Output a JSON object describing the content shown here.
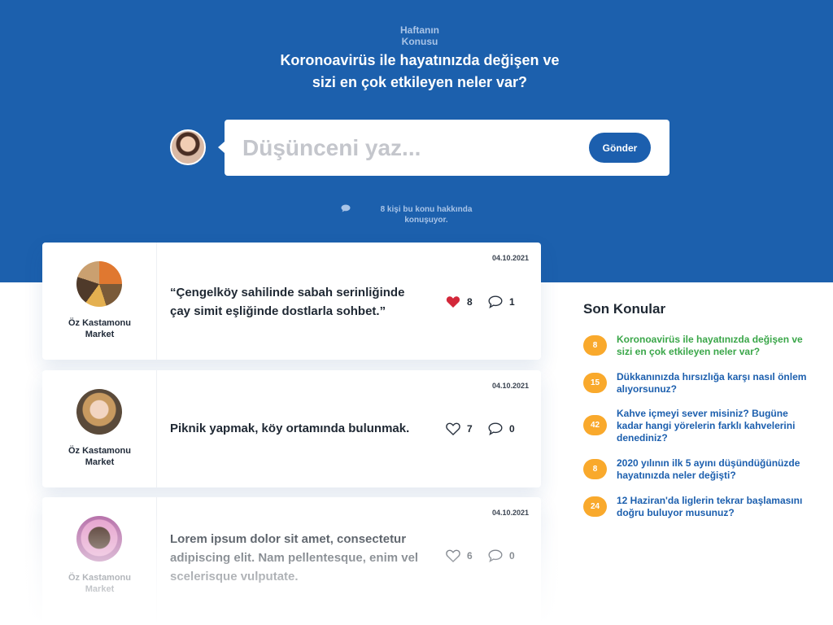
{
  "hero": {
    "kicker_line1": "Haftanın",
    "kicker_line2": "Konusu",
    "title_line1": "Koronoavirüs ile hayatınızda değişen ve",
    "title_line2": "sizi en çok etkileyen neler var?",
    "bg_color": "#1c60ad"
  },
  "composer": {
    "placeholder": "Düşünceni yaz...",
    "send_label": "Gönder",
    "user_avatar_icon": "user-avatar"
  },
  "talking": {
    "icon": "comment-icon",
    "line1": "8 kişi bu konu hakkında",
    "line2": "konuşuyor."
  },
  "posts": [
    {
      "author_line1": "Öz Kastamonu",
      "author_line2": "Market",
      "date": "04.10.2021",
      "text": "“Çengelköy sahilinde sabah serinliğinde çay simit eşliğinde dostlarla sohbet.”",
      "likes": "8",
      "comments": "1",
      "liked": true
    },
    {
      "author_line1": "Öz Kastamonu",
      "author_line2": "Market",
      "date": "04.10.2021",
      "text": "Piknik yapmak, köy ortamında bulunmak.",
      "likes": "7",
      "comments": "0",
      "liked": false
    },
    {
      "author_line1": "Öz Kastamonu",
      "author_line2": "Market",
      "date": "04.10.2021",
      "text": "Lorem ipsum dolor sit amet, consectetur adipiscing elit. Nam pellentesque, enim vel scelerisque vulputate.",
      "likes": "6",
      "comments": "0",
      "liked": false
    }
  ],
  "sidebar": {
    "title": "Son Konular",
    "topics": [
      {
        "count": "8",
        "text": "Koronoavirüs ile hayatınızda değişen ve sizi en çok etkileyen neler var?",
        "active": true
      },
      {
        "count": "15",
        "text": "Dükkanınızda hırsızlığa karşı nasıl önlem alıyorsunuz?",
        "active": false
      },
      {
        "count": "42",
        "text": "Kahve içmeyi sever misiniz? Bugüne kadar hangi yörelerin farklı kahvelerini denediniz?",
        "active": false
      },
      {
        "count": "8",
        "text": "2020 yılının ilk 5 ayını düşündüğünüzde hayatınızda neler değişti?",
        "active": false
      },
      {
        "count": "24",
        "text": "12 Haziran'da liglerin tekrar başlamasını doğru buluyor musunuz?",
        "active": false
      }
    ]
  },
  "colors": {
    "accent": "#1c5fae",
    "badge": "#f9a92c",
    "active_topic": "#3aa649",
    "like_red": "#d3283a"
  }
}
